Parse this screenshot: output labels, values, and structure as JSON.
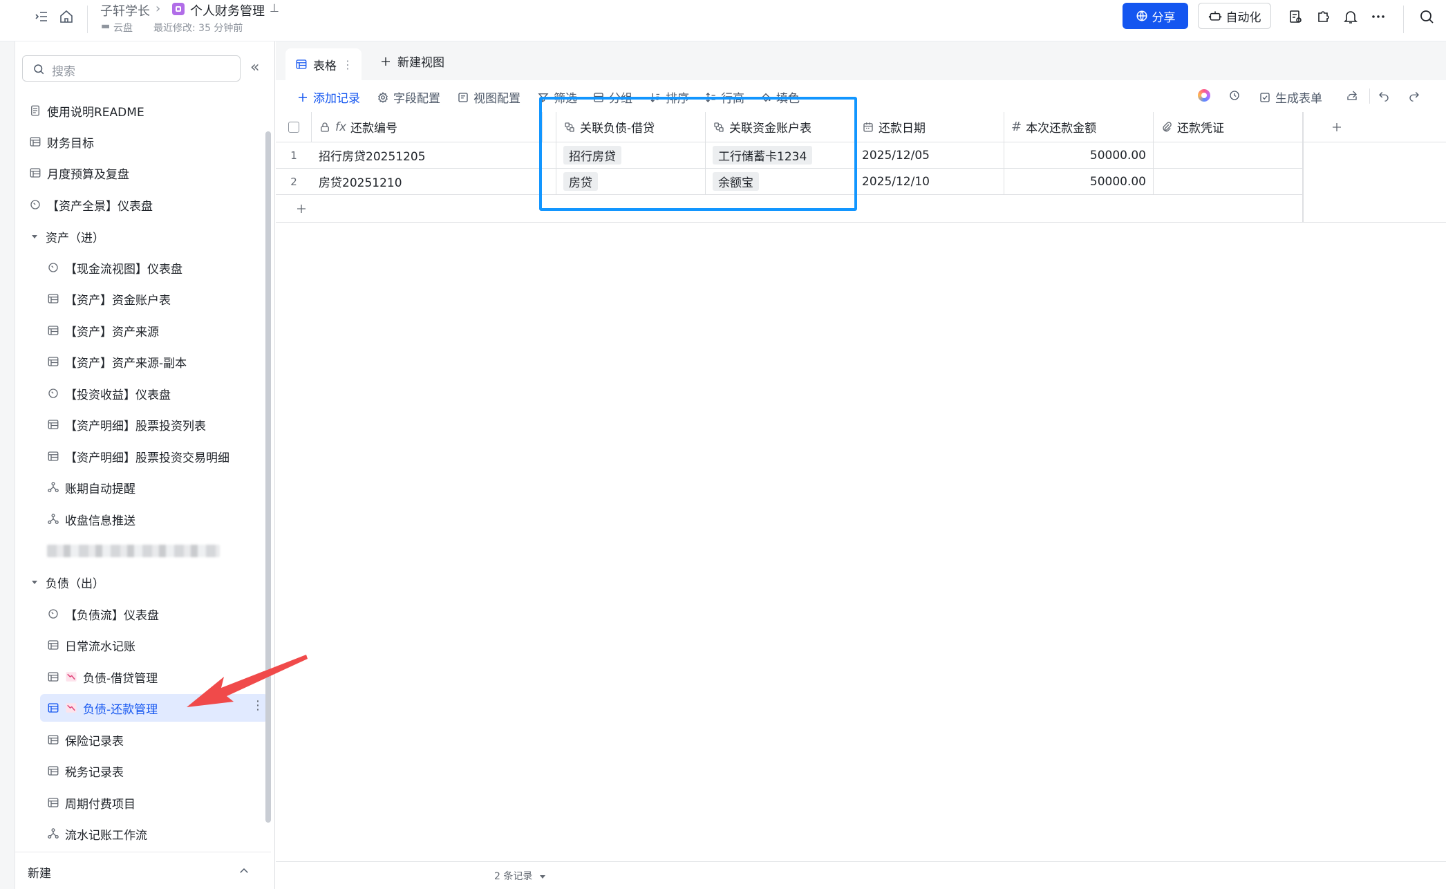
{
  "header": {
    "breadcrumb_parent": "子轩学长",
    "title": "个人财务管理",
    "location": "云盘",
    "last_modified": "最近修改: 35 分钟前",
    "share_label": "分享",
    "automation_label": "自动化"
  },
  "sidebar": {
    "search_placeholder": "搜索",
    "items": [
      {
        "label": "使用说明README"
      },
      {
        "label": "财务目标"
      },
      {
        "label": "月度预算及复盘"
      },
      {
        "label": "【资产全景】仪表盘"
      },
      {
        "label": "资产（进）"
      },
      {
        "label": "【现金流视图】仪表盘"
      },
      {
        "label": "【资产】资金账户表"
      },
      {
        "label": "【资产】资产来源"
      },
      {
        "label": "【资产】资产来源-副本"
      },
      {
        "label": "【投资收益】仪表盘"
      },
      {
        "label": "【资产明细】股票投资列表"
      },
      {
        "label": "【资产明细】股票投资交易明细"
      },
      {
        "label": "账期自动提醒"
      },
      {
        "label": "收盘信息推送"
      },
      {
        "label": "负债（出）"
      },
      {
        "label": "【负债流】仪表盘"
      },
      {
        "label": "日常流水记账"
      },
      {
        "label": "负债-借贷管理"
      },
      {
        "label": "负债-还款管理"
      },
      {
        "label": "保险记录表"
      },
      {
        "label": "税务记录表"
      },
      {
        "label": "周期付费项目"
      },
      {
        "label": "流水记账工作流"
      }
    ],
    "new_label": "新建"
  },
  "views": {
    "active_tab": "表格",
    "new_view": "新建视图"
  },
  "toolbar": {
    "add_record": "添加记录",
    "field_config": "字段配置",
    "view_config": "视图配置",
    "filter": "筛选",
    "group": "分组",
    "sort": "排序",
    "row_height": "行高",
    "fill_color": "填色",
    "generate_form": "生成表单"
  },
  "table": {
    "columns": [
      "还款编号",
      "关联负债-借贷",
      "关联资金账户表",
      "还款日期",
      "本次还款金额",
      "还款凭证"
    ],
    "rows": [
      {
        "index": "1",
        "id": "招行房贷20251205",
        "debt": "招行房贷",
        "account": "工行储蓄卡1234",
        "date": "2025/12/05",
        "amount": "50000.00",
        "voucher": ""
      },
      {
        "index": "2",
        "id": "房贷20251210",
        "debt": "房贷",
        "account": "余额宝",
        "date": "2025/12/10",
        "amount": "50000.00",
        "voucher": ""
      }
    ],
    "record_count": "2 条记录"
  },
  "colors": {
    "accent": "#1456f0",
    "highlight_box": "#1296ff",
    "arrow": "#f04a4a"
  }
}
